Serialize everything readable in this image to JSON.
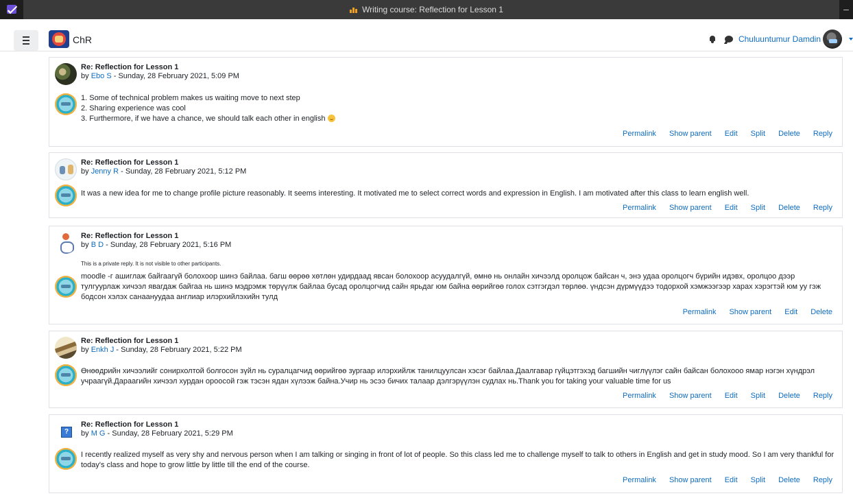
{
  "window": {
    "title": "Writing course: Reflection for Lesson 1",
    "minimize_glyph": "–"
  },
  "navbar": {
    "site_name": "ChR",
    "user_name": "Chuluuntumur Damdin",
    "icons": [
      "menu-icon",
      "site-logo",
      "bell-icon",
      "chat-icon",
      "avatar",
      "chevron-down-icon"
    ]
  },
  "actions": {
    "permalink": "Permalink",
    "show_parent": "Show parent",
    "edit": "Edit",
    "split": "Split",
    "delete": "Delete",
    "reply": "Reply"
  },
  "posts": [
    {
      "subject": "Re: Reflection for Lesson 1",
      "by": "by",
      "author": "Ebo S",
      "date": "- Sunday, 28 February 2021, 5:09 PM",
      "lines": [
        "1. Some of technical problem makes us waiting move to next step",
        "2. Sharing experience was cool",
        "3. Furthermore, if we have a chance, we should talk each other in english"
      ]
    },
    {
      "subject": "Re: Reflection for Lesson 1",
      "by": "by",
      "author": "Jenny R",
      "date": "- Sunday, 28 February 2021, 5:12 PM",
      "body": "It was a new idea for me to change profile picture reasonably. It seems interesting. It motivated me to select correct words and expression in English. I am motivated after this class to learn english well."
    },
    {
      "subject": "Re: Reflection for Lesson 1",
      "by": "by",
      "author": "B D",
      "date": "- Sunday, 28 February 2021, 5:16 PM",
      "private_note": "This is a private reply. It is not visible to other participants.",
      "body": "moodle -г ашиглаж байгаагүй болохоор шинэ байлаа. багш өөрөө хөтлөн удирдаад явсан болохоор асуудалгүй, өмнө нь онлайн хичээлд оролцож байсан ч, энэ удаа оролцогч бүрийн идэвх, оролцоо дээр тулгуурлаж хичээл явагдаж байгаа нь шинэ мэдрэмж төрүүлж байлаа бусад оролцогчид сайн ярьдаг юм байна өөрийгөө голох сэтгэгдэл төрлөө. үндсэн дүрмүүдээ тодорхой хэмжээгээр харах хэрэгтэй юм уу гэж бодсон хэлэх санаануудаа англиар илэрхийлэхийн тулд"
    },
    {
      "subject": "Re: Reflection for Lesson 1",
      "by": "by",
      "author": "Enkh J",
      "date": "- Sunday, 28 February 2021, 5:22 PM",
      "body": "Өнөөдрийн хичээлийг сонирхолтой болгосон зүйл нь суралцагчид өөрийгөө зургаар илэрхийлж танилцуулсан хэсэг байлаа.Даалгавар гүйцэтгэхэд багшийн чиглүүлэг сайн байсан болохооо ямар нэгэн хүндрэл учраагүй.Дараагийн хичээл хурдан ороосой гэж тэсэн ядан хүлээж байна.Учир нь эсээ бичих талаар дэлгэрүүлэн судлах нь.Thank you for taking your valuable time for us"
    },
    {
      "subject": "Re: Reflection for Lesson 1",
      "by": "by",
      "author": "M G",
      "date": "- Sunday, 28 February 2021, 5:29 PM",
      "body": "I recently realized myself as very shy and nervous person when I am talking or singing in front of lot of people. So this class led me to challenge myself to talk to others in English and get in study mood. So I am very thankful for today's class and hope to grow little by little till the end of the course."
    }
  ]
}
